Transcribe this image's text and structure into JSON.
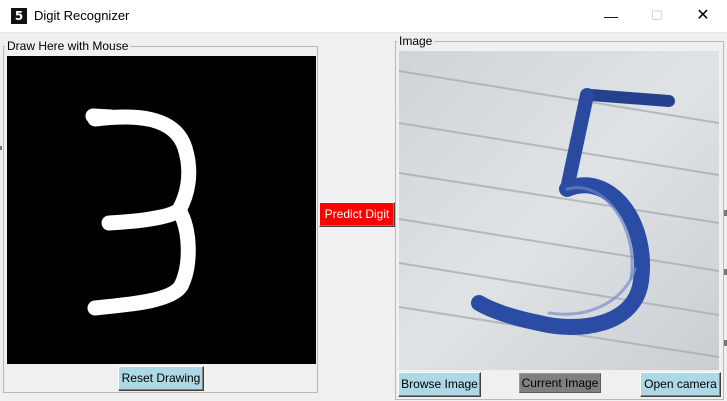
{
  "window": {
    "title": "Digit Recognizer",
    "app_icon_glyph": "5",
    "minimize_icon": "minimize-icon",
    "maximize_icon": "maximize-icon",
    "close_icon": "close-icon",
    "minimize_glyph": "—",
    "maximize_glyph": "☐",
    "close_glyph": "✕"
  },
  "draw_panel": {
    "legend": "Draw Here with Mouse",
    "canvas_background": "#000000",
    "stroke_color": "#ffffff",
    "drawn_digit": "3",
    "reset_label": "Reset Drawing"
  },
  "center": {
    "predict_label": "Predict Digit",
    "predict_color": "#ff0000"
  },
  "image_panel": {
    "legend": "Image",
    "photo_subject": "handwritten digit 5 on ruled paper",
    "browse_label": "Browse Image",
    "current_label": "Current Image",
    "camera_label": "Open camera"
  },
  "colors": {
    "button_light_blue": "#add8e6",
    "current_gray": "#808080",
    "ink_blue": "#2a4aa0"
  }
}
